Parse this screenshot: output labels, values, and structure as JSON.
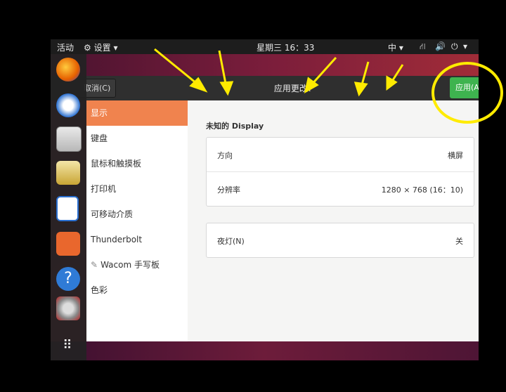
{
  "topbar": {
    "activities": "活动",
    "app_menu": "设置",
    "clock": "星期三 16：33",
    "input_method": "中"
  },
  "header": {
    "cancel_label": "取消(C)",
    "title": "应用更改?",
    "apply_label": "应用(A"
  },
  "sidebar": {
    "items": [
      {
        "label": "显示"
      },
      {
        "label": "键盘"
      },
      {
        "label": "鼠标和触摸板"
      },
      {
        "label": "打印机"
      },
      {
        "label": "可移动介质"
      },
      {
        "label": "Thunderbolt"
      },
      {
        "label": "Wacom 手写板"
      },
      {
        "label": "色彩"
      }
    ]
  },
  "display": {
    "section_label": "未知的 Display",
    "rows": [
      {
        "label": "方向",
        "value": "横屏"
      },
      {
        "label": "分辨率",
        "value": "1280 × 768 (16：10)"
      }
    ],
    "night_light": {
      "label": "夜灯(N)",
      "value": "关"
    }
  },
  "colors": {
    "accent": "#f0834e",
    "apply": "#3eb34f",
    "annotation": "#ffeb00"
  },
  "dock": {
    "icons": [
      "firefox-icon",
      "thunderbird-icon",
      "files-icon",
      "rhythmbox-icon",
      "libreoffice-writer-icon",
      "software-center-icon",
      "help-icon",
      "settings-icon",
      "app-grid-icon"
    ]
  }
}
